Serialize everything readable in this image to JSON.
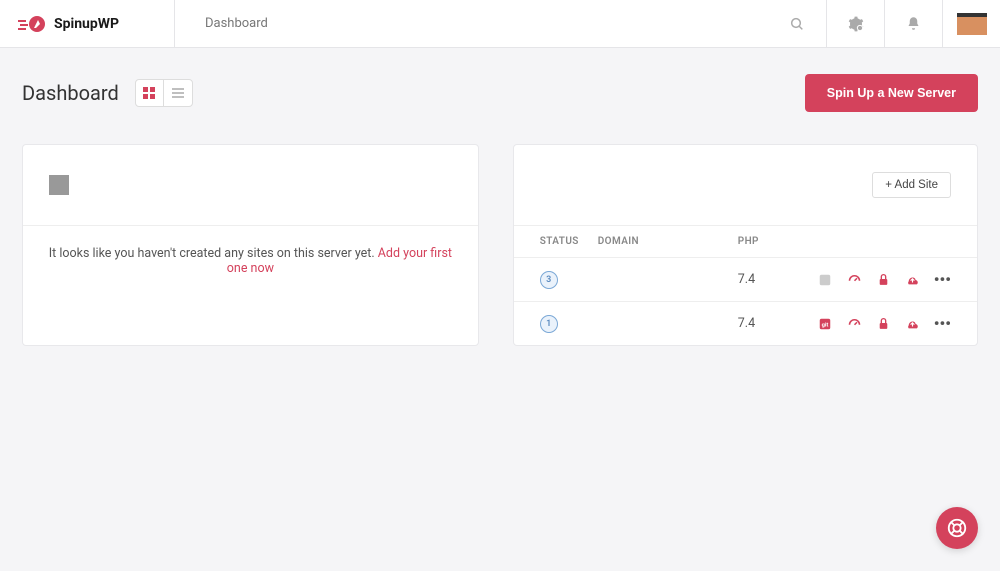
{
  "brand": "SpinupWP",
  "breadcrumb": "Dashboard",
  "page_title": "Dashboard",
  "primary_button": "Spin Up a New Server",
  "add_site_label": "+ Add Site",
  "empty_state": {
    "text": "It looks like you haven't created any sites on this server yet. ",
    "link": "Add your first one now"
  },
  "table": {
    "headers": {
      "status": "STATUS",
      "domain": "DOMAIN",
      "php": "PHP"
    },
    "rows": [
      {
        "status": "3",
        "domain": "",
        "php": "7.4",
        "git_muted": true
      },
      {
        "status": "1",
        "domain": "",
        "php": "7.4",
        "git_muted": false
      }
    ]
  },
  "colors": {
    "accent": "#d4425c",
    "badge_border": "#7ba8d6"
  }
}
